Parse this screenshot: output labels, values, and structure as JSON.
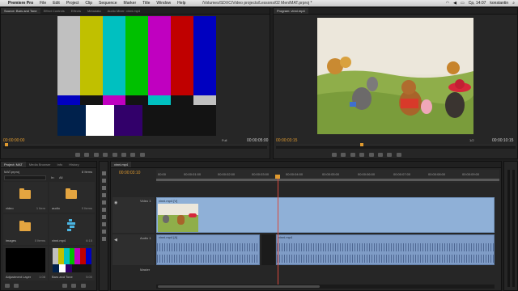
{
  "menubar": {
    "app": "Premiere Pro",
    "items": [
      "File",
      "Edit",
      "Project",
      "Clip",
      "Sequence",
      "Marker",
      "Title",
      "Window",
      "Help"
    ],
    "path": "/Volumes/SDXC/Video projects/Lessons/02 Men/MAT.prproj *",
    "clock": "Ср, 14:07",
    "user": "konstantin"
  },
  "source_panel": {
    "tabs": [
      "Source: Bars and Tone",
      "Effect Controls",
      "Effects",
      "Metadata",
      "Audio Mixer: vinni.mp4"
    ],
    "timecode_left": "00:00:00:00",
    "fit": "Full",
    "timecode_right": "00:00:05:00"
  },
  "program_panel": {
    "tabs": [
      "Program: vinni.mp4"
    ],
    "timecode_left": "00:00:03:15",
    "fit": "1/2",
    "timecode_right": "00:00:10:15"
  },
  "project_panel": {
    "tabs": [
      "Project: MAT",
      "Media Browser",
      "Info",
      "History"
    ],
    "project_file": "MAT.prproj",
    "item_count": "8 Items",
    "in_label": "In:",
    "in_value": "All",
    "bins": [
      {
        "name": "video",
        "count": "1 Item",
        "type": "folder"
      },
      {
        "name": "audio",
        "count": "0 Items",
        "type": "folder"
      },
      {
        "name": "images",
        "count": "0 Items",
        "type": "folder"
      },
      {
        "name": "vinni.mp4",
        "count": "6:15",
        "type": "sequence"
      },
      {
        "name": "Adjustment Layer",
        "count": "1:08",
        "type": "adjustment"
      },
      {
        "name": "Bars and Tone",
        "count": "5:00",
        "type": "bars"
      }
    ]
  },
  "timeline": {
    "tab": "vinni.mp4",
    "timecode": "00:00:03:10",
    "ruler": [
      "00:00",
      "00:00:01:00",
      "00:00:02:00",
      "00:00:03:00",
      "00:00:04:00",
      "00:00:05:00",
      "00:00:06:00",
      "00:00:07:00",
      "00:00:08:00",
      "00:00:09:00"
    ],
    "video_track": {
      "name": "Video 1",
      "clip": "vinni.mp4 [V]"
    },
    "audio_track": {
      "name": "Audio 1",
      "clip_left": "vinni.mp4 [A]",
      "clip_right": "vinni.mp4"
    },
    "master_label": "Master"
  },
  "colors": {
    "timecode": "#e09a2f",
    "clip_video": "#8fb0d7",
    "clip_audio": "#7f9cc6",
    "playhead": "#d9483b"
  }
}
